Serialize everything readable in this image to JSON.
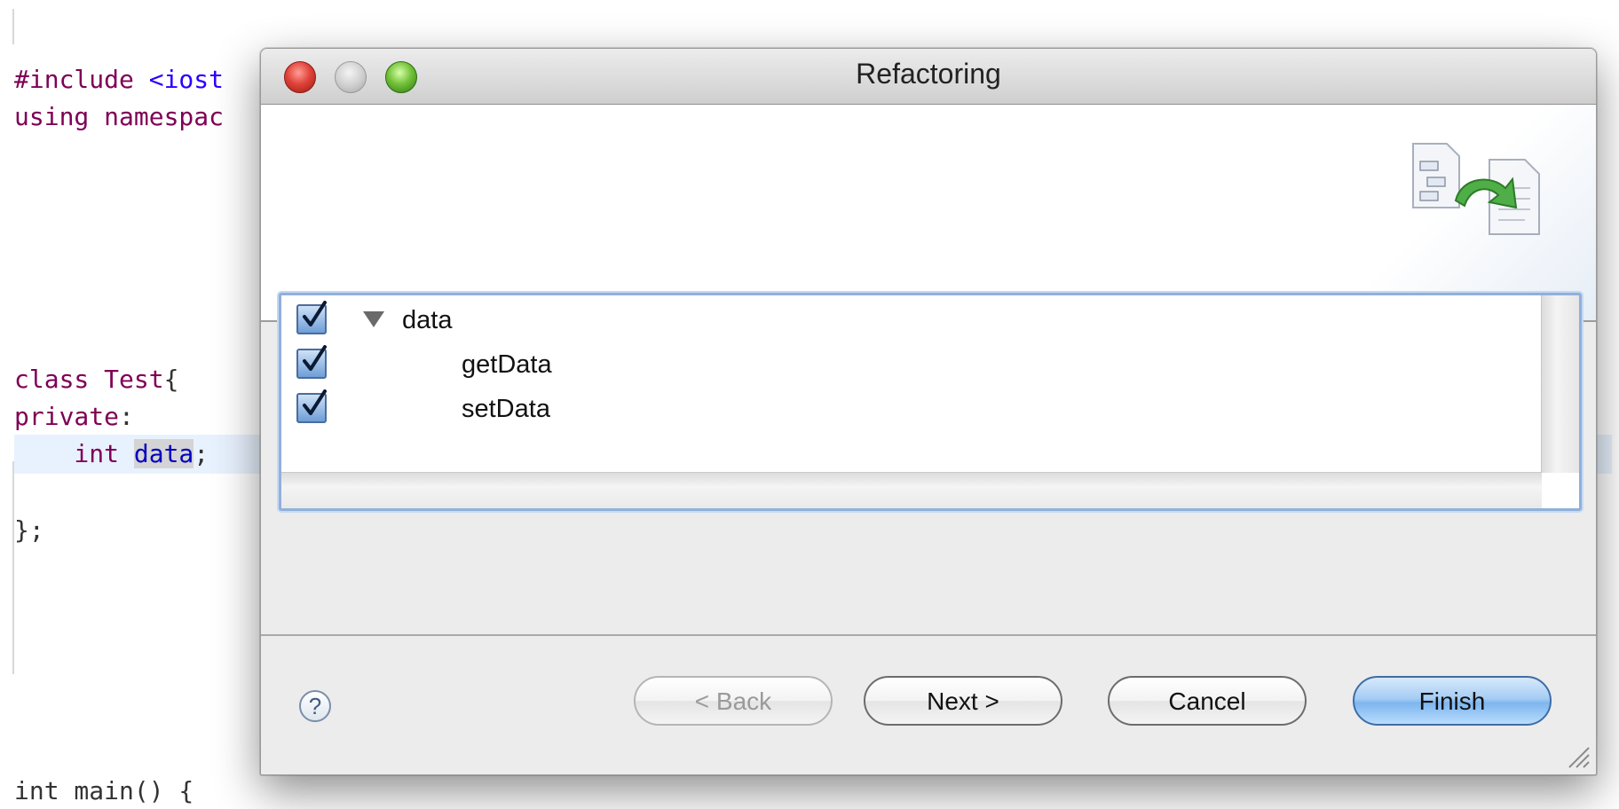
{
  "editor": {
    "lines": [
      {
        "tokens": [
          {
            "t": "#include ",
            "c": "kw"
          },
          {
            "t": "<iost",
            "c": "str"
          }
        ]
      },
      {
        "tokens": [
          {
            "t": "using namespac",
            "c": "kw"
          }
        ]
      },
      {
        "tokens": [
          {
            "t": "class ",
            "c": "kw"
          },
          {
            "t": "Test",
            "c": "ty"
          },
          {
            "t": "{",
            "c": ""
          }
        ]
      },
      {
        "tokens": [
          {
            "t": "private",
            "c": "kw"
          },
          {
            "t": ":",
            "c": ""
          }
        ]
      },
      {
        "tokens": [
          {
            "t": "    int ",
            "c": "kw"
          },
          {
            "t": "data",
            "c": "var sel"
          },
          {
            "t": ";",
            "c": ""
          }
        ]
      },
      {
        "tokens": [
          {
            "t": "};",
            "c": ""
          }
        ]
      },
      {
        "tokens": [
          {
            "t": "int main() {",
            "c": ""
          }
        ]
      }
    ]
  },
  "dialog": {
    "title": "Refactoring",
    "tree": [
      {
        "label": "data",
        "checked": true,
        "expanded": true
      },
      {
        "label": "getData",
        "checked": true
      },
      {
        "label": "setData",
        "checked": true
      }
    ],
    "buttons": {
      "help": "?",
      "back": "< Back",
      "next": "Next >",
      "cancel": "Cancel",
      "finish": "Finish"
    }
  },
  "colors": {
    "accent": "#7eb6ef",
    "code_keyword": "#7f0055",
    "code_string": "#2a00ff",
    "code_variable": "#0000c0"
  }
}
